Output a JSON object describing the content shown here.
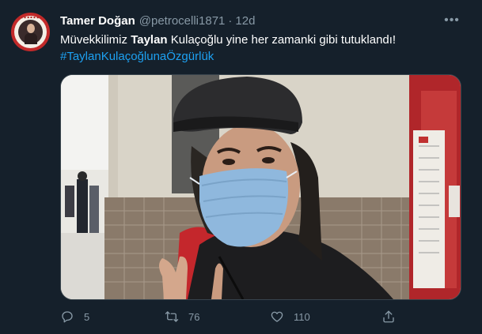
{
  "tweet": {
    "author_name": "Tamer Doğan",
    "handle": "@petrocelli1871",
    "separator": "·",
    "age": "12d",
    "text_before": "Müvekkilimiz ",
    "text_bold": "Taylan",
    "text_after": " Kulaçoğlu yine her zamanki gibi tutuklandı!",
    "hashtag": "#TaylanKulaçoğlunaÖzgürlük",
    "more_label": "•••"
  },
  "actions": {
    "reply_count": "5",
    "retweet_count": "76",
    "like_count": "110"
  },
  "icons": {
    "reply": "reply-icon",
    "retweet": "retweet-icon",
    "like": "heart-icon",
    "share": "share-icon"
  },
  "colors": {
    "background": "#15202b",
    "muted": "#8899a6",
    "link": "#1da1f2"
  }
}
